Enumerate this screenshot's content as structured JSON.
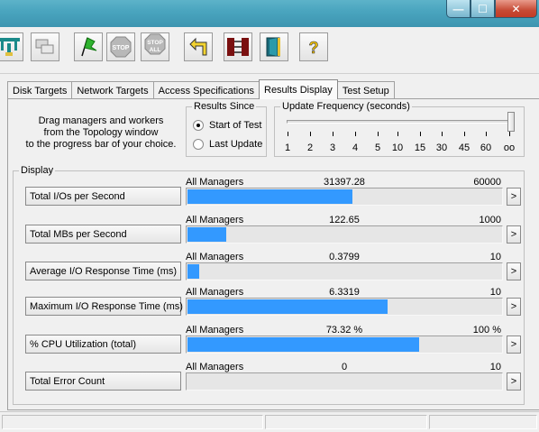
{
  "window": {
    "controls": {
      "minimize": "—",
      "maximize": "☐",
      "close": "✕"
    }
  },
  "toolbar": {
    "buttons": [
      {
        "name": "topology-icon"
      },
      {
        "name": "new-worker-icon"
      },
      {
        "name": "start-flag-icon"
      },
      {
        "name": "stop-icon",
        "label": "STOP"
      },
      {
        "name": "stop-all-icon",
        "label": "STOP ALL"
      },
      {
        "name": "reset-icon"
      },
      {
        "name": "disconnect-icon"
      },
      {
        "name": "exit-door-icon"
      },
      {
        "name": "help-icon",
        "label": "?"
      }
    ]
  },
  "tabs": [
    {
      "label": "Disk Targets",
      "active": false
    },
    {
      "label": "Network Targets",
      "active": false
    },
    {
      "label": "Access Specifications",
      "active": false
    },
    {
      "label": "Results Display",
      "active": true
    },
    {
      "label": "Test Setup",
      "active": false
    }
  ],
  "hint": {
    "line1": "Drag managers and workers",
    "line2": "from the Topology window",
    "line3": "to the progress bar of your choice."
  },
  "results_since": {
    "title": "Results Since",
    "options": [
      {
        "label": "Start of Test",
        "selected": true
      },
      {
        "label": "Last Update",
        "selected": false
      }
    ]
  },
  "update_frequency": {
    "title": "Update Frequency (seconds)",
    "ticks": [
      "1",
      "2",
      "3",
      "4",
      "5",
      "10",
      "15",
      "30",
      "45",
      "60",
      "oo"
    ],
    "selected": "oo"
  },
  "display": {
    "title": "Display",
    "metrics": [
      {
        "label": "Total I/Os per Second",
        "source": "All Managers",
        "value": "31397.28",
        "max": "60000",
        "fraction": 0.5233
      },
      {
        "label": "Total MBs per Second",
        "source": "All Managers",
        "value": "122.65",
        "max": "1000",
        "fraction": 0.1227
      },
      {
        "label": "Average I/O Response Time (ms)",
        "source": "All Managers",
        "value": "0.3799",
        "max": "10",
        "fraction": 0.038
      },
      {
        "label": "Maximum I/O Response Time (ms)",
        "source": "All Managers",
        "value": "6.3319",
        "max": "10",
        "fraction": 0.6332
      },
      {
        "label": "% CPU Utilization (total)",
        "source": "All Managers",
        "value": "73.32 %",
        "max": "100 %",
        "fraction": 0.7332
      },
      {
        "label": "Total Error Count",
        "source": "All Managers",
        "value": "0",
        "max": "10",
        "fraction": 0
      }
    ],
    "more_label": ">"
  },
  "colors": {
    "bar": "#3399ff",
    "titlebar": "#4aa5bf"
  }
}
